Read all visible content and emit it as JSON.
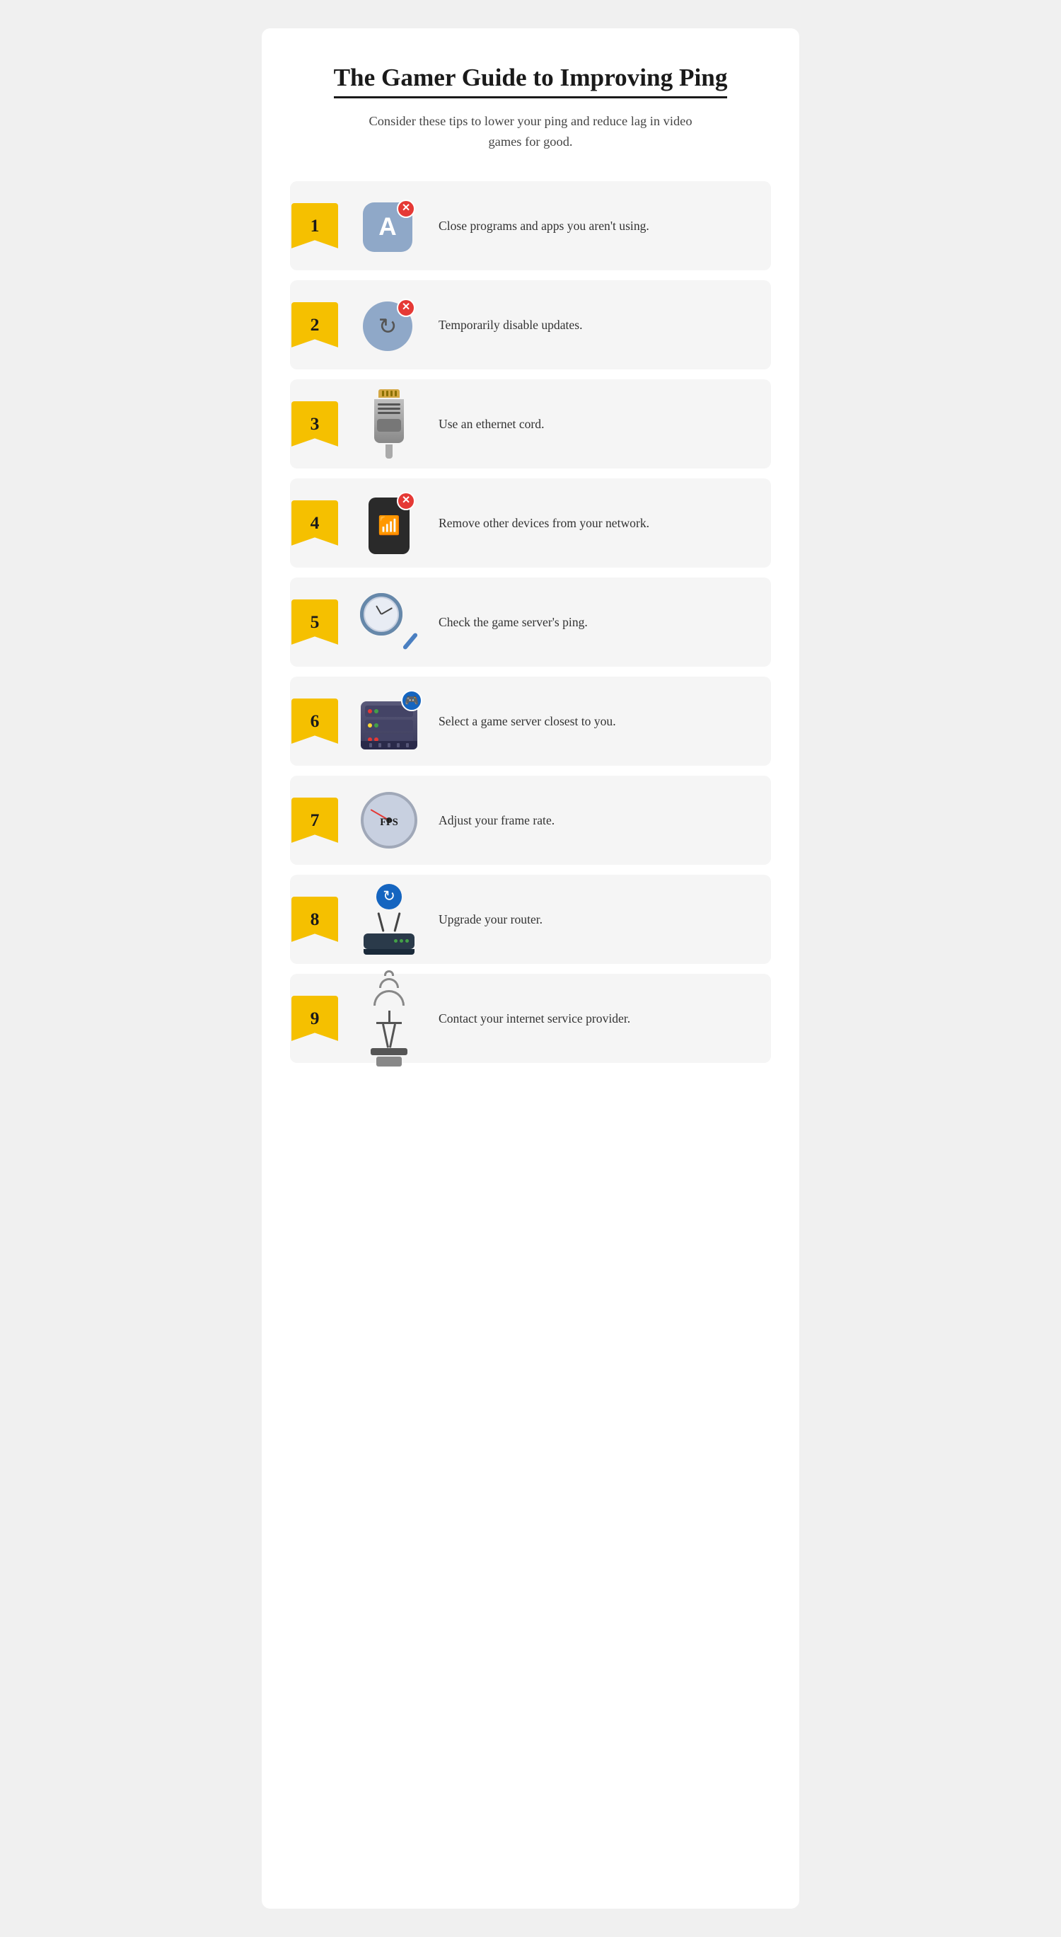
{
  "header": {
    "title": "The Gamer Guide to Improving Ping",
    "subtitle": "Consider these tips to lower your ping and reduce lag in video games for good."
  },
  "tips": [
    {
      "number": "1",
      "text": "Close programs and apps you aren't using.",
      "icon_type": "app"
    },
    {
      "number": "2",
      "text": "Temporarily disable updates.",
      "icon_type": "refresh"
    },
    {
      "number": "3",
      "text": "Use an ethernet cord.",
      "icon_type": "ethernet"
    },
    {
      "number": "4",
      "text": "Remove other devices from your network.",
      "icon_type": "phone"
    },
    {
      "number": "5",
      "text": "Check the game server's ping.",
      "icon_type": "search-clock"
    },
    {
      "number": "6",
      "text": "Select a game server closest to you.",
      "icon_type": "server"
    },
    {
      "number": "7",
      "text": "Adjust your frame rate.",
      "icon_type": "fps"
    },
    {
      "number": "8",
      "text": "Upgrade your router.",
      "icon_type": "router"
    },
    {
      "number": "9",
      "text": "Contact your internet service provider.",
      "icon_type": "tower"
    }
  ]
}
